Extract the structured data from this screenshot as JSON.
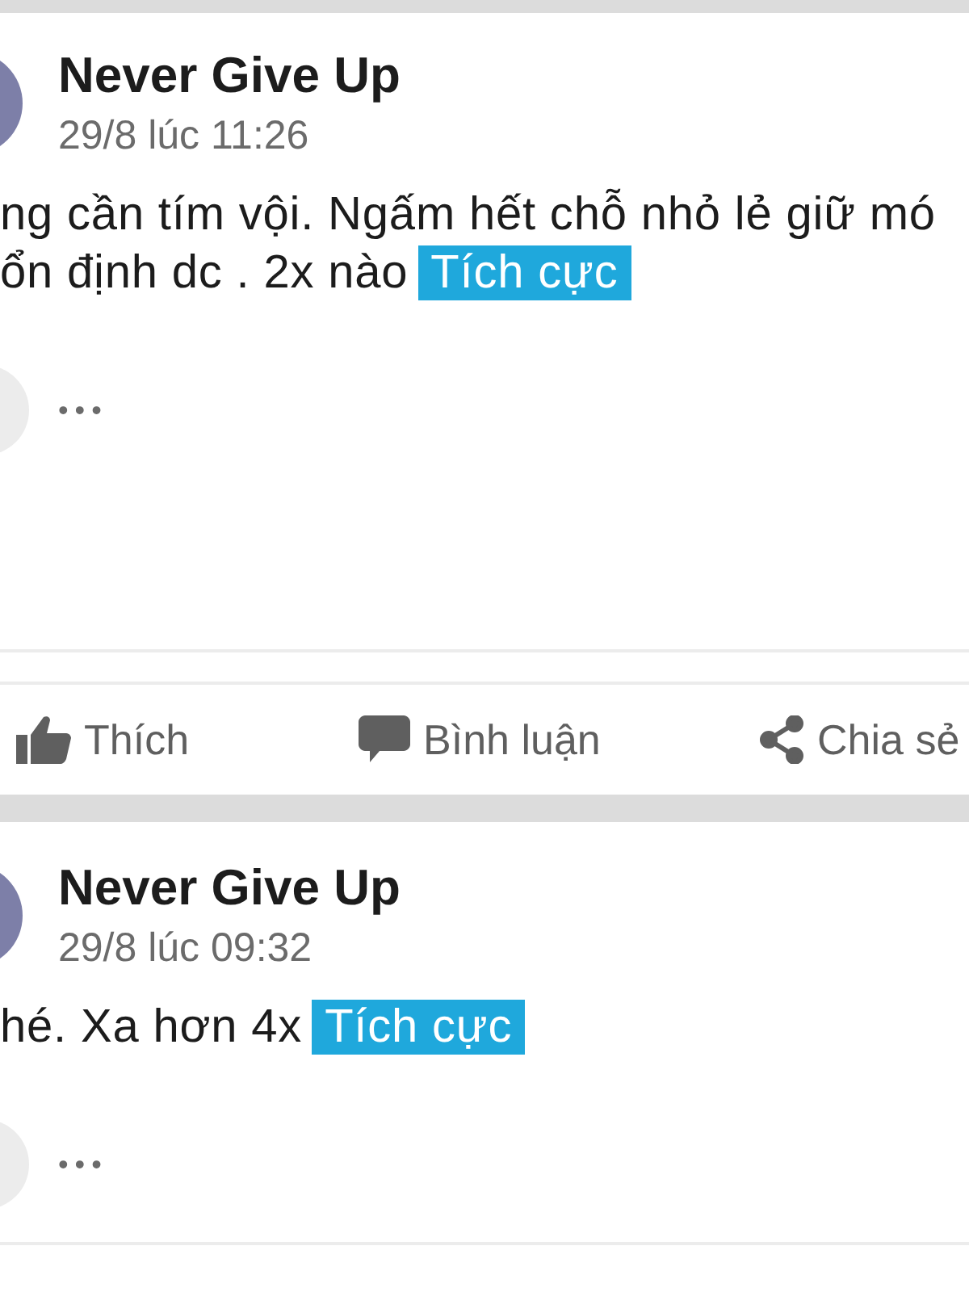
{
  "posts": [
    {
      "author": "Never Give Up",
      "time": "29/8 lúc 11:26",
      "lines": [
        "ng cần tím vội. Ngấm hết chỗ nhỏ lẻ giữ mó",
        "ổn định dc . 2x nào"
      ],
      "tag": "Tích cực",
      "more": "•••",
      "actions": [
        {
          "kind": "like",
          "label": "Thích"
        },
        {
          "kind": "comment",
          "label": "Bình luận"
        },
        {
          "kind": "share",
          "label": "Chia sẻ"
        }
      ]
    },
    {
      "author": "Never Give Up",
      "time": "29/8 lúc 09:32",
      "lines": [
        "hé. Xa hơn 4x"
      ],
      "tag": "Tích cực",
      "more": "•••"
    }
  ]
}
